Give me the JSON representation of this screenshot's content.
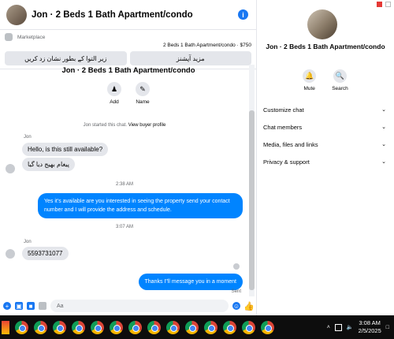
{
  "chat": {
    "title": "Jon · 2 Beds 1 Bath Apartment/condo",
    "info_icon": "info-icon",
    "marketplace_label": "Marketplace",
    "listing_line": "2 Beds 1 Bath Apartment/condo · $750",
    "button_left": "زیر التوا کے بطور نشان زد کریں",
    "button_right": "مزید آپشنز",
    "conv_title": "Jon · 2 Beds 1 Bath Apartment/condo",
    "add_label": "Add",
    "name_label": "Name",
    "started_text": "Jon started this chat.",
    "buyer_profile_link": "View buyer profile",
    "sender_name_1": "Jon",
    "msg_in_1": "Hello, is this still available?",
    "msg_in_2": "پیغام بھیج دیا گیا",
    "time_1": "2:38 AM",
    "msg_out_1": "Yes it's available are you interested in seeing the property send your contact number and I will provide the address and schedule.",
    "time_2": "3:07 AM",
    "sender_name_2": "Jon",
    "msg_in_3": "5593731077",
    "msg_out_2": "Thanks I\"ll message you in a moment",
    "sent_status": "Sent",
    "composer_placeholder": "Aa"
  },
  "sidebar": {
    "title": "Jon · 2 Beds 1 Bath Apartment/condo",
    "mute_label": "Mute",
    "search_label": "Search",
    "menu": [
      "Customize chat",
      "Chat members",
      "Media, files and links",
      "Privacy & support"
    ]
  },
  "taskbar": {
    "time": "3:08 AM",
    "date": "2/5/2025"
  },
  "colors": {
    "accent": "#1877f2",
    "outgoing_bubble": "#0084ff",
    "incoming_bubble": "#e4e6eb"
  }
}
